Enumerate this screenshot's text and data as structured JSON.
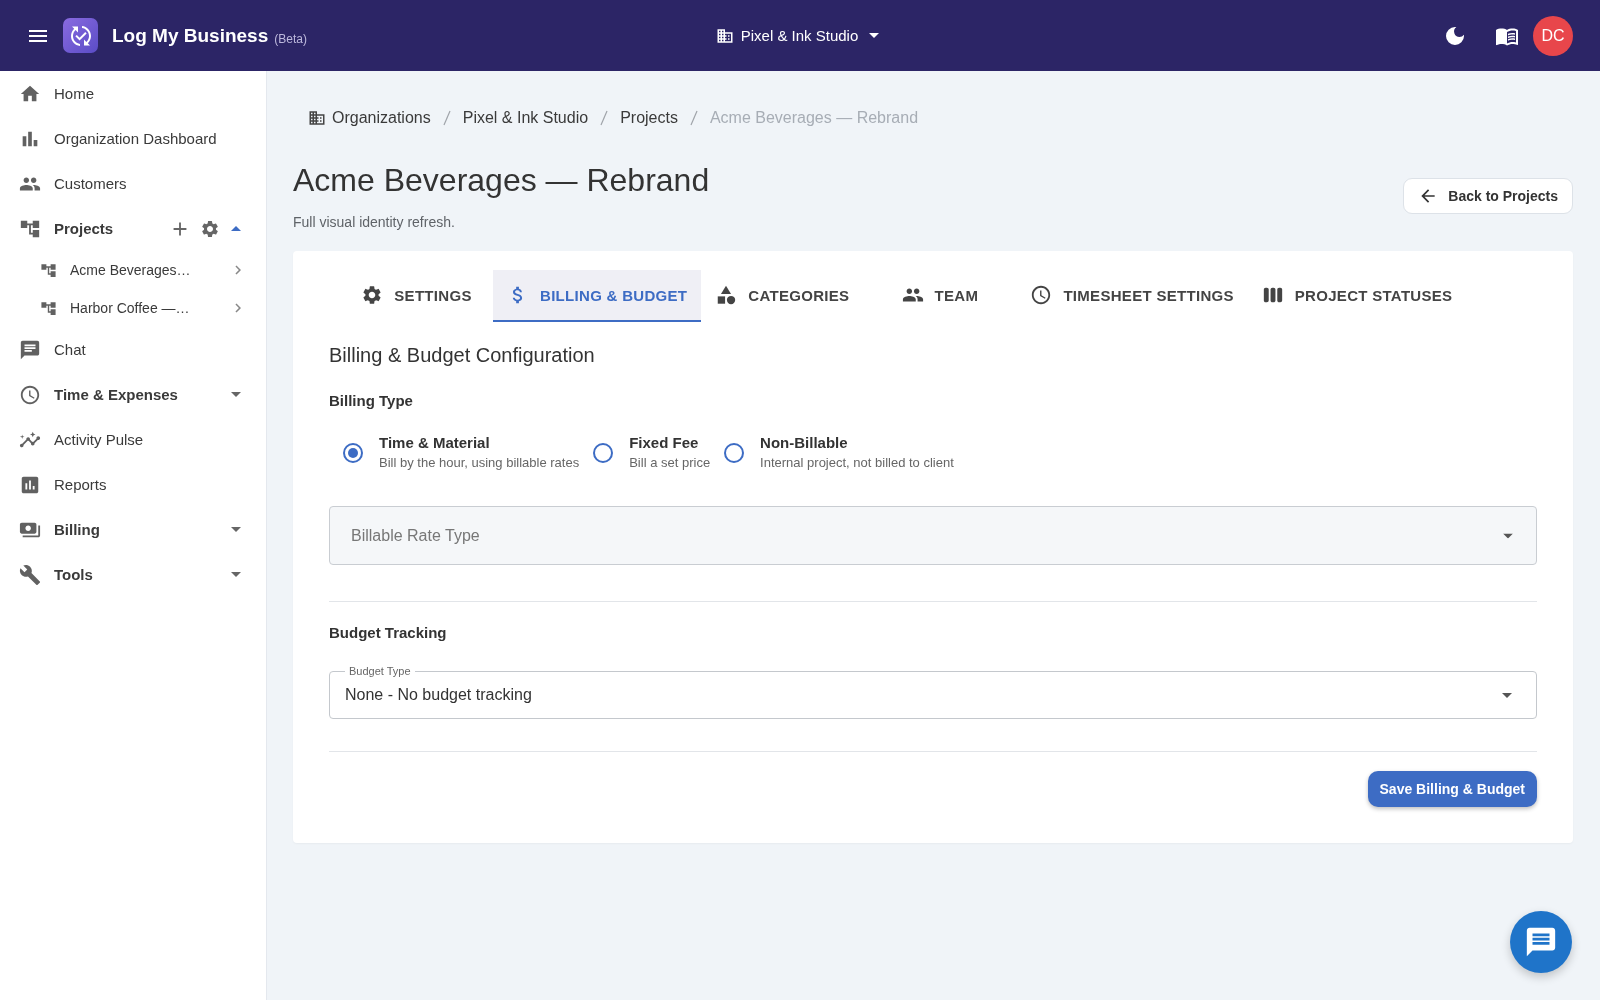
{
  "app_bar": {
    "title": "Log My Business",
    "tag": "(Beta)",
    "organization": "Pixel & Ink Studio",
    "avatar_initials": "DC"
  },
  "sidebar": {
    "items": [
      {
        "kind": "link",
        "label": "Home"
      },
      {
        "kind": "link",
        "label": "Organization Dashboard"
      },
      {
        "kind": "link",
        "label": "Customers"
      },
      {
        "kind": "editable_group",
        "label": "Projects",
        "expanded": true,
        "children": [
          {
            "label": "Acme Beverages…"
          },
          {
            "label": "Harbor Coffee —…"
          }
        ]
      },
      {
        "kind": "link",
        "label": "Chat"
      },
      {
        "kind": "group",
        "label": "Time & Expenses",
        "expanded": false
      },
      {
        "kind": "link",
        "label": "Activity Pulse"
      },
      {
        "kind": "link",
        "label": "Reports"
      },
      {
        "kind": "group",
        "label": "Billing",
        "expanded": false
      },
      {
        "kind": "group",
        "label": "Tools",
        "expanded": false
      }
    ]
  },
  "breadcrumb": [
    {
      "label": "Organizations",
      "current": false
    },
    {
      "label": "Pixel & Ink Studio",
      "current": false
    },
    {
      "label": "Projects",
      "current": false
    },
    {
      "label": "Acme Beverages — Rebrand",
      "current": true
    }
  ],
  "header": {
    "title": "Acme Beverages — Rebrand",
    "subtitle": "Full visual identity refresh.",
    "back_button": "Back to Projects"
  },
  "tabs": [
    {
      "label": "SETTINGS",
      "selected": false
    },
    {
      "label": "BILLING & BUDGET",
      "selected": true
    },
    {
      "label": "CATEGORIES",
      "selected": false
    },
    {
      "label": "TEAM",
      "selected": false
    },
    {
      "label": "TIMESHEET SETTINGS",
      "selected": false
    },
    {
      "label": "PROJECT STATUSES",
      "selected": false
    }
  ],
  "billing": {
    "heading": "Billing & Budget Configuration",
    "billing_type": {
      "label": "Billing Type",
      "options": [
        {
          "title": "Time & Material",
          "description": "Bill by the hour, using billable rates",
          "selected": true
        },
        {
          "title": "Fixed Fee",
          "description": "Bill a set price",
          "selected": false
        },
        {
          "title": "Non-Billable",
          "description": "Internal project, not billed to client",
          "selected": false
        }
      ]
    },
    "rate_type": {
      "placeholder": "Billable Rate Type"
    },
    "budget_tracking": {
      "label": "Budget Tracking",
      "field": {
        "label": "Budget Type",
        "value": "None - No budget tracking"
      }
    },
    "save_button": "Save Billing & Budget"
  }
}
